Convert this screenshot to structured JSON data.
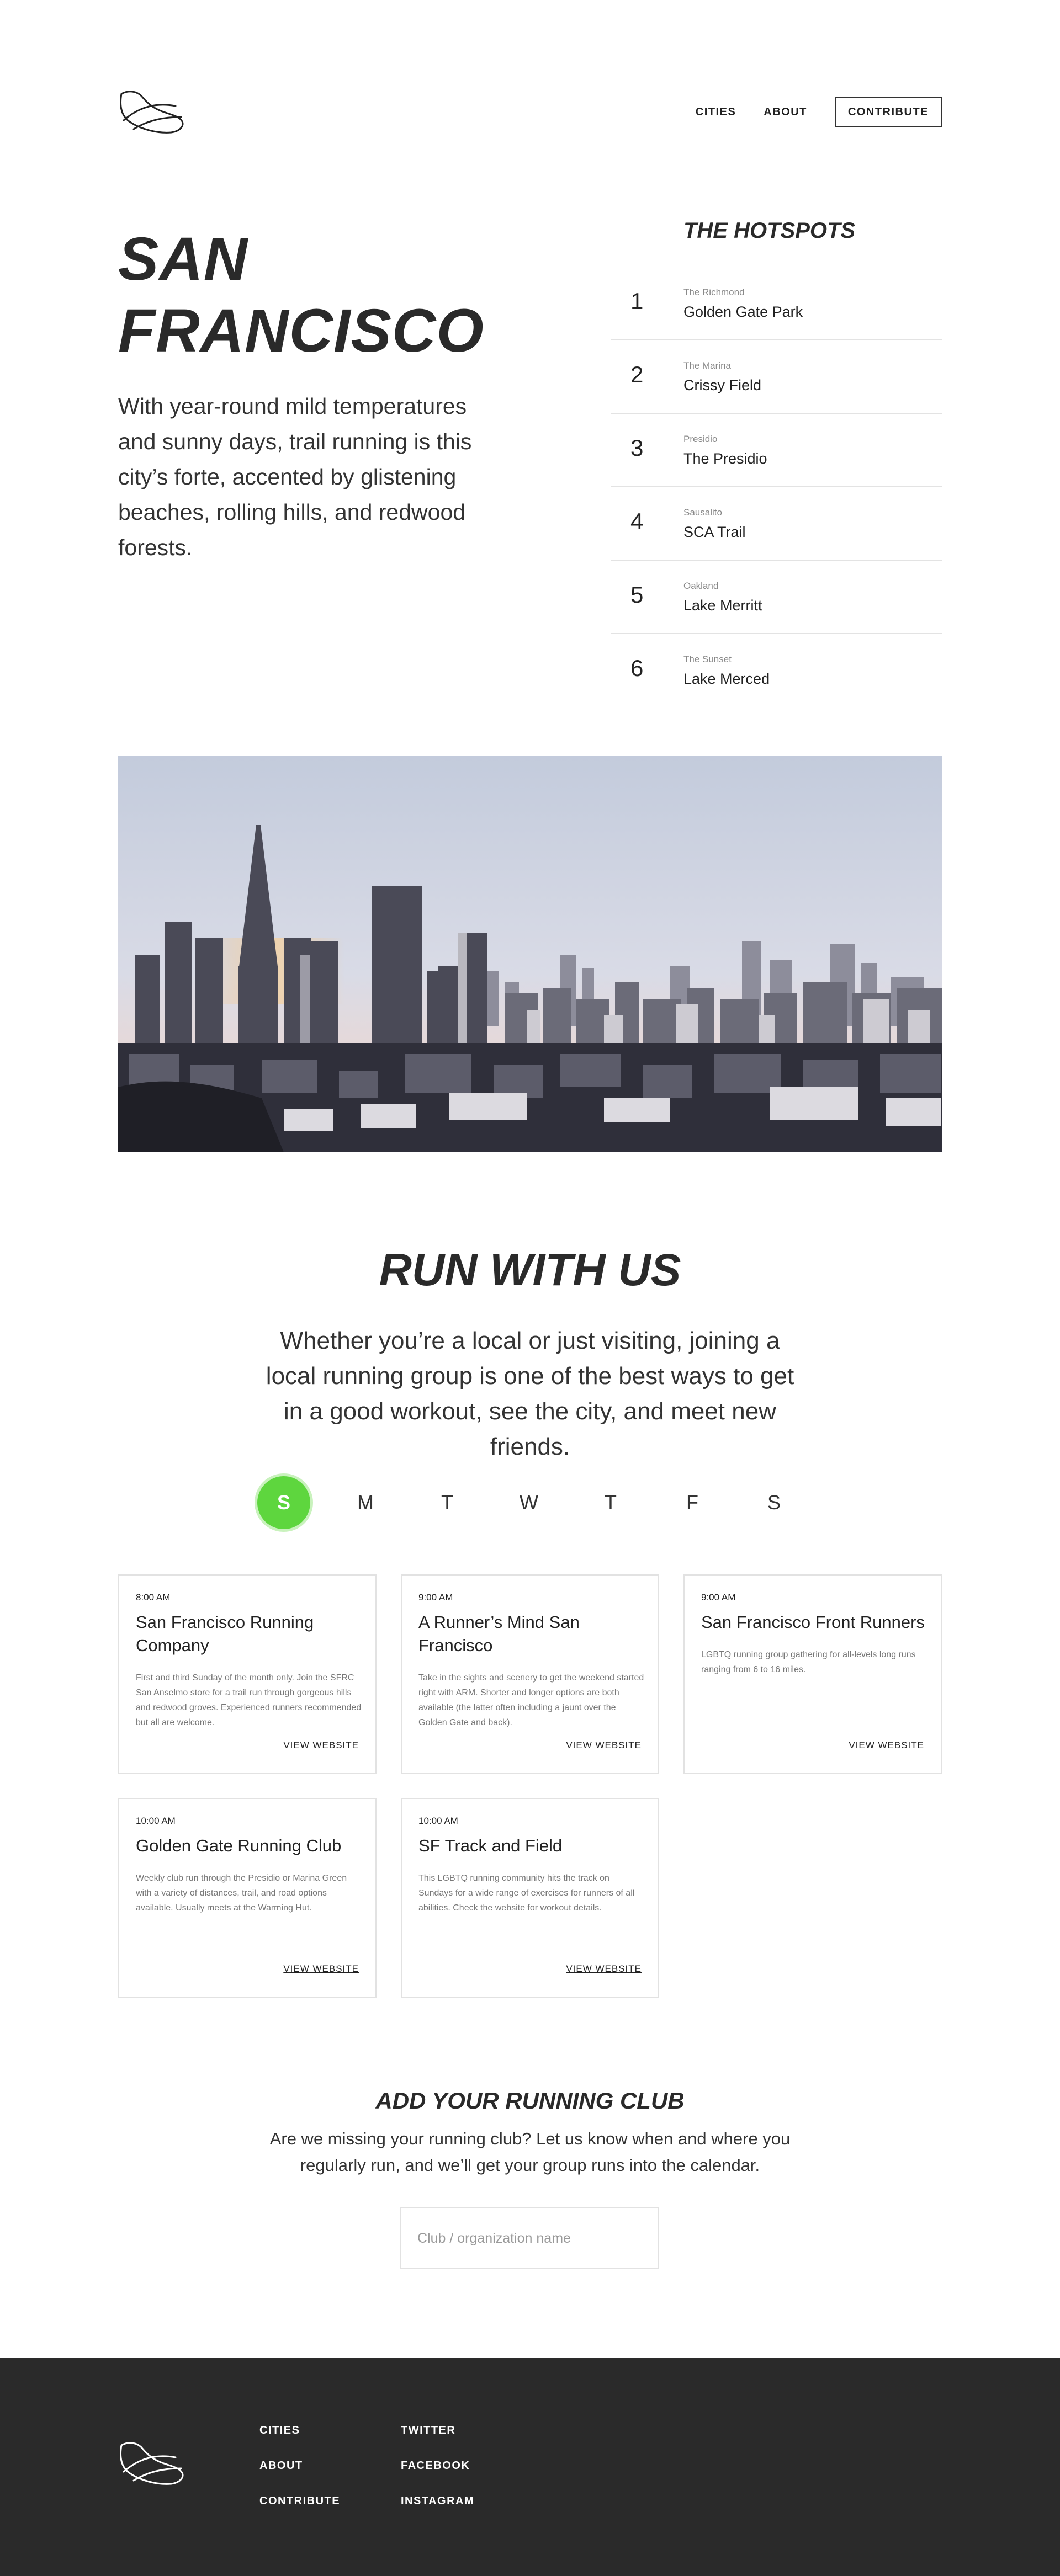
{
  "nav": {
    "cities": "CITIES",
    "about": "ABOUT",
    "contribute": "CONTRIBUTE"
  },
  "hero": {
    "title_line1": "SAN",
    "title_line2": "FRANCISCO",
    "description": "With year-round mild temperatures and sunny days, trail running is this city’s forte, accented by glistening beaches, rolling hills, and redwood forests."
  },
  "hotspots": {
    "title": "THE HOTSPOTS",
    "items": [
      {
        "num": "1",
        "area": "The Richmond",
        "name": "Golden Gate Park"
      },
      {
        "num": "2",
        "area": "The Marina",
        "name": "Crissy Field"
      },
      {
        "num": "3",
        "area": "Presidio",
        "name": "The Presidio"
      },
      {
        "num": "4",
        "area": "Sausalito",
        "name": "SCA Trail"
      },
      {
        "num": "5",
        "area": "Oakland",
        "name": "Lake Merritt"
      },
      {
        "num": "6",
        "area": "The Sunset",
        "name": "Lake Merced"
      }
    ]
  },
  "run": {
    "title": "RUN WITH US",
    "description": "Whether you’re a local or just visiting, joining a local running group is one of the best ways to get in a good workout, see the city, and meet new friends.",
    "days": [
      "S",
      "M",
      "T",
      "W",
      "T",
      "F",
      "S"
    ],
    "active_day_index": 0,
    "active_color": "#5ed63e",
    "view_website_label": "VIEW WEBSITE",
    "clubs": [
      {
        "time": "8:00 AM",
        "name": "San Francisco Running Company",
        "desc": "First and third Sunday of the month only. Join the SFRC San Anselmo store for a trail run through gorgeous hills and redwood groves. Experienced runners recommended but all are welcome."
      },
      {
        "time": "9:00 AM",
        "name": "A Runner’s Mind San Francisco",
        "desc": "Take in the sights and scenery to get the weekend started right with ARM. Shorter and longer options are both available (the latter often including a jaunt over the Golden Gate and back)."
      },
      {
        "time": "9:00 AM",
        "name": "San Francisco Front Runners",
        "desc": "LGBTQ running group gathering for all-levels long runs ranging from 6 to 16 miles."
      },
      {
        "time": "10:00 AM",
        "name": "Golden Gate Running Club",
        "desc": "Weekly club run through the Presidio or Marina Green with a variety of distances, trail, and road options available. Usually meets at the Warming Hut."
      },
      {
        "time": "10:00 AM",
        "name": "SF Track and Field",
        "desc": "This LGBTQ running community hits the track on Sundays for a wide range of exercises for runners of all abilities. Check the website for workout details."
      }
    ]
  },
  "add_club": {
    "title": "ADD YOUR RUNNING CLUB",
    "description": "Are we missing your running club? Let us know when and where you regularly run, and we’ll get your group runs into the calendar.",
    "input_placeholder": "Club / organization name",
    "input_value": ""
  },
  "footer": {
    "col1": [
      "CITIES",
      "ABOUT",
      "CONTRIBUTE"
    ],
    "col2": [
      "TWITTER",
      "FACEBOOK",
      "INSTAGRAM"
    ]
  },
  "colors": {
    "dark": "#2a2a2a",
    "accent": "#5ed63e"
  },
  "icons": {
    "logo": "running-shoe-icon"
  }
}
